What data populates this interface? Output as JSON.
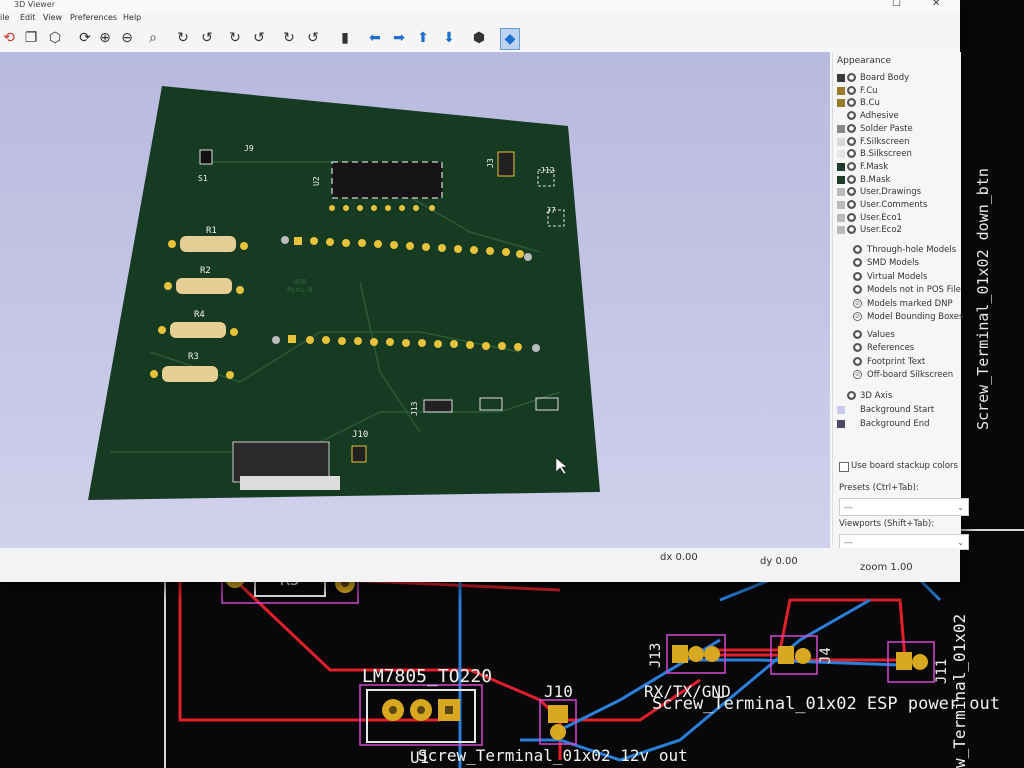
{
  "window": {
    "title": "3D Viewer"
  },
  "menu": [
    "ile",
    "Edit",
    "View",
    "Preferences",
    "Help"
  ],
  "board_refs": {
    "S1": "S1",
    "J9": "J9",
    "U2": "U2",
    "J3": "J3",
    "J12": "J12",
    "J7": "J7",
    "R1": "R1",
    "R2": "R2",
    "R4": "R4",
    "R3": "R3",
    "J13": "J13",
    "J10": "J10",
    "usb": "USB Mini-B"
  },
  "appearance": {
    "title": "Appearance",
    "layers": [
      {
        "name": "Board Body",
        "color": "#3a3a3a"
      },
      {
        "name": "F.Cu",
        "color": "#9c7a2c"
      },
      {
        "name": "B.Cu",
        "color": "#9c7a2c"
      },
      {
        "name": "Adhesive",
        "color": "#f6f6f6"
      },
      {
        "name": "Solder Paste",
        "color": "#888888"
      },
      {
        "name": "F.Silkscreen",
        "color": "#d9d9d9"
      },
      {
        "name": "B.Silkscreen",
        "color": "#e6e6e6"
      },
      {
        "name": "F.Mask",
        "color": "#1f3b2a"
      },
      {
        "name": "B.Mask",
        "color": "#1f3b2a"
      },
      {
        "name": "User.Drawings",
        "color": "#bbbbbb"
      },
      {
        "name": "User.Comments",
        "color": "#bbbbbb"
      },
      {
        "name": "User.Eco1",
        "color": "#bbbbbb"
      },
      {
        "name": "User.Eco2",
        "color": "#bbbbbb"
      }
    ],
    "models": [
      {
        "name": "Through-hole Models",
        "on": true
      },
      {
        "name": "SMD Models",
        "on": true
      },
      {
        "name": "Virtual Models",
        "on": true
      },
      {
        "name": "Models not in POS File",
        "on": true
      },
      {
        "name": "Models marked DNP",
        "on": false
      },
      {
        "name": "Model Bounding Boxes",
        "on": false
      }
    ],
    "annotations": [
      {
        "name": "Values",
        "on": true
      },
      {
        "name": "References",
        "on": true
      },
      {
        "name": "Footprint Text",
        "on": true
      },
      {
        "name": "Off-board Silkscreen",
        "on": false
      }
    ],
    "axis": "3D Axis",
    "bg_start": "Background Start",
    "bg_end": "Background End",
    "bg_start_color": "#c8cbe8",
    "bg_end_color": "#4a4a66",
    "stackup_label": "Use board stackup colors",
    "presets_label": "Presets (Ctrl+Tab):",
    "presets_value": "---",
    "viewports_label": "Viewports (Shift+Tab):",
    "viewports_value": "---"
  },
  "status": {
    "dx": "dx 0.00",
    "dy": "dy 0.00",
    "zoom": "zoom 1.00"
  },
  "pcb": {
    "r3_ref": "R3",
    "r3_val": "R3",
    "u1_val": "LM7805_TO220",
    "u1_ref": "U1",
    "j10": "J10",
    "j13": "J13",
    "j4": "J4",
    "j11": "J11",
    "rxtx": "RX/TX/GND",
    "screw_label1": "Screw_Terminal_01x02 ESP power out",
    "screw_label2": "Screw_Terminal_01x02 12v out",
    "right_vertical": "w_Terminal_01x02",
    "right_vertical2": "Screw_Terminal_01x02 down_btn"
  },
  "colors": {
    "accent": "#1c6fd0",
    "pcb_trace_red": "#e0202a",
    "pcb_trace_blue": "#2a7fd8",
    "board_green": "#173a22"
  }
}
